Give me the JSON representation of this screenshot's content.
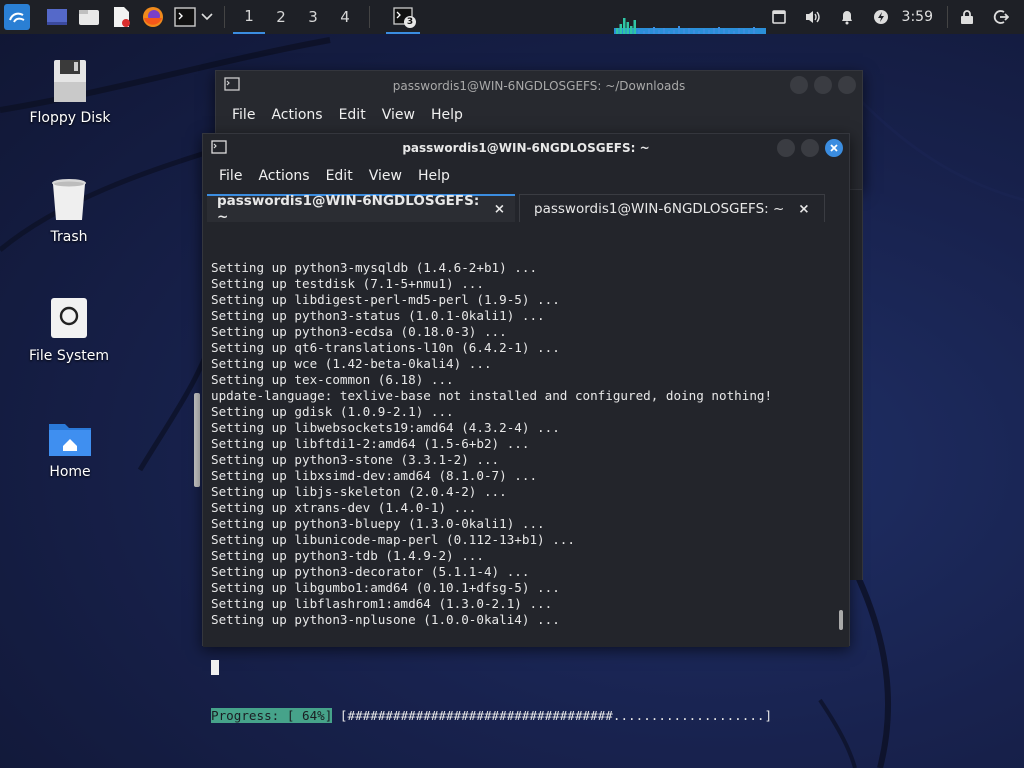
{
  "taskbar": {
    "workspaces": [
      "1",
      "2",
      "3",
      "4"
    ],
    "task_badge": "3",
    "clock": "3:59",
    "icons": [
      "kali-menu-icon",
      "desktop-icon",
      "file-manager-icon",
      "text-editor-icon",
      "firefox-icon",
      "terminal-icon",
      "chevron-down-icon"
    ],
    "tray_icons": [
      "clipboard-icon",
      "volume-icon",
      "notification-bell-icon",
      "power-manager-icon",
      "lock-icon",
      "logout-icon"
    ]
  },
  "desktop": {
    "icons": [
      {
        "label": "Floppy Disk"
      },
      {
        "label": "Trash"
      },
      {
        "label": "File System"
      },
      {
        "label": "Home"
      }
    ]
  },
  "back_window": {
    "title": "passwordis1@WIN-6NGDLOSGEFS: ~/Downloads",
    "menu": [
      "File",
      "Actions",
      "Edit",
      "View",
      "Help"
    ]
  },
  "front_window": {
    "title": "passwordis1@WIN-6NGDLOSGEFS: ~",
    "menu": [
      "File",
      "Actions",
      "Edit",
      "View",
      "Help"
    ],
    "tabs": [
      {
        "label": "passwordis1@WIN-6NGDLOSGEFS: ~",
        "close": "×"
      },
      {
        "label": "passwordis1@WIN-6NGDLOSGEFS: ~",
        "close": "×"
      }
    ],
    "lines": [
      "Setting up python3-mysqldb (1.4.6-2+b1) ...",
      "Setting up testdisk (7.1-5+nmu1) ...",
      "Setting up libdigest-perl-md5-perl (1.9-5) ...",
      "Setting up python3-status (1.0.1-0kali1) ...",
      "Setting up python3-ecdsa (0.18.0-3) ...",
      "Setting up qt6-translations-l10n (6.4.2-1) ...",
      "Setting up wce (1.42-beta-0kali4) ...",
      "Setting up tex-common (6.18) ...",
      "update-language: texlive-base not installed and configured, doing nothing!",
      "Setting up gdisk (1.0.9-2.1) ...",
      "Setting up libwebsockets19:amd64 (4.3.2-4) ...",
      "Setting up libftdi1-2:amd64 (1.5-6+b2) ...",
      "Setting up python3-stone (3.3.1-2) ...",
      "Setting up libxsimd-dev:amd64 (8.1.0-7) ...",
      "Setting up libjs-skeleton (2.0.4-2) ...",
      "Setting up xtrans-dev (1.4.0-1) ...",
      "Setting up python3-bluepy (1.3.0-0kali1) ...",
      "Setting up libunicode-map-perl (0.112-13+b1) ...",
      "Setting up python3-tdb (1.4.9-2) ...",
      "Setting up python3-decorator (5.1.1-4) ...",
      "Setting up libgumbo1:amd64 (0.10.1+dfsg-5) ...",
      "Setting up libflashrom1:amd64 (1.3.0-2.1) ...",
      "Setting up python3-nplusone (1.0.0-0kali4) ..."
    ],
    "progress_label": "Progress: [ 64%]",
    "progress_bar": " [###################################....................]",
    "progress_fraction": 0.64
  },
  "colors": {
    "accent": "#3b8de0",
    "progress_bg": "#46a38a",
    "terminal_bg": "#23252b"
  }
}
